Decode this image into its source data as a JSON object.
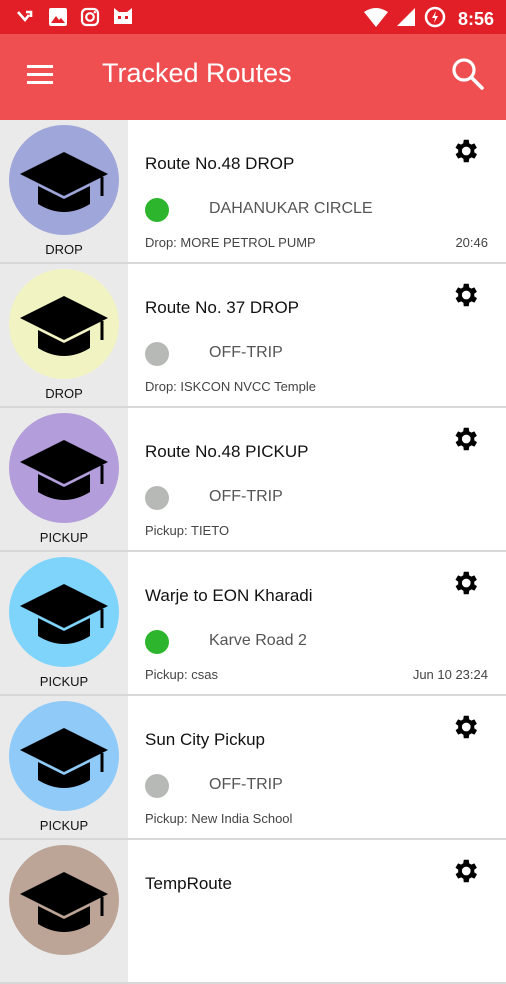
{
  "status_bar": {
    "time": "8:56"
  },
  "app_bar": {
    "title": "Tracked Routes"
  },
  "colors": {
    "status_bar": "#e21f26",
    "app_bar": "#ef4f51",
    "online": "#2db52d",
    "offline": "#b7b9b6"
  },
  "routes": [
    {
      "thumb_label": "DROP",
      "avatar_color": "#9fa6da",
      "name": "Route No.48 DROP",
      "status": "DAHANUKAR CIRCLE",
      "online": true,
      "stop": "Drop: MORE PETROL PUMP",
      "time": "20:46"
    },
    {
      "thumb_label": "DROP",
      "avatar_color": "#f2f3c2",
      "name": "Route No. 37 DROP",
      "status": "OFF-TRIP",
      "online": false,
      "stop": "Drop: ISKCON NVCC Temple",
      "time": ""
    },
    {
      "thumb_label": "PICKUP",
      "avatar_color": "#b39ddb",
      "name": "Route No.48 PICKUP",
      "status": "OFF-TRIP",
      "online": false,
      "stop": "Pickup: TIETO",
      "time": ""
    },
    {
      "thumb_label": "PICKUP",
      "avatar_color": "#7fd4fb",
      "name": "Warje to EON Kharadi",
      "status": "Karve Road 2",
      "online": true,
      "stop": "Pickup: csas",
      "time": "Jun 10 23:24"
    },
    {
      "thumb_label": "PICKUP",
      "avatar_color": "#90caf8",
      "name": "Sun City Pickup",
      "status": "OFF-TRIP",
      "online": false,
      "stop": "Pickup: New India School",
      "time": ""
    },
    {
      "thumb_label": "",
      "avatar_color": "#bca597",
      "name": "TempRoute",
      "status": "",
      "online": false,
      "stop": "",
      "time": ""
    }
  ]
}
